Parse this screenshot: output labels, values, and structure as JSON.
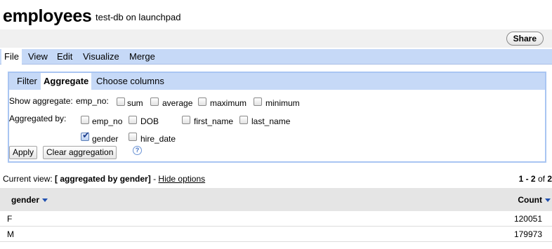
{
  "header": {
    "title": "employees",
    "subtitle": "test-db on launchpad",
    "share_label": "Share"
  },
  "menu": [
    "File",
    "View",
    "Edit",
    "Visualize",
    "Merge"
  ],
  "panel": {
    "tabs": [
      "Filter",
      "Aggregate",
      "Choose columns"
    ],
    "show_aggregate_label": "Show aggregate:",
    "aggregate_column": "emp_no:",
    "aggregate_functions": [
      {
        "label": "sum",
        "checked": false
      },
      {
        "label": "average",
        "checked": false
      },
      {
        "label": "maximum",
        "checked": false
      },
      {
        "label": "minimum",
        "checked": false
      }
    ],
    "aggregated_by_label": "Aggregated by:",
    "group_columns": [
      {
        "label": "emp_no",
        "checked": false
      },
      {
        "label": "DOB",
        "checked": false
      },
      {
        "label": "first_name",
        "checked": false
      },
      {
        "label": "last_name",
        "checked": false
      },
      {
        "label": "gender",
        "checked": true
      },
      {
        "label": "hire_date",
        "checked": false
      }
    ],
    "help_glyph": "?",
    "apply_label": "Apply",
    "clear_label": "Clear aggregation"
  },
  "view": {
    "prefix": "Current view:",
    "description": "[ aggregated by gender]",
    "separator": "-",
    "hide_options": "Hide options",
    "paging_range": "1 - 2",
    "paging_of": "of",
    "paging_total": "2"
  },
  "table": {
    "columns": [
      "gender",
      "Count"
    ],
    "rows": [
      [
        "F",
        "120051"
      ],
      [
        "M",
        "179973"
      ]
    ]
  }
}
